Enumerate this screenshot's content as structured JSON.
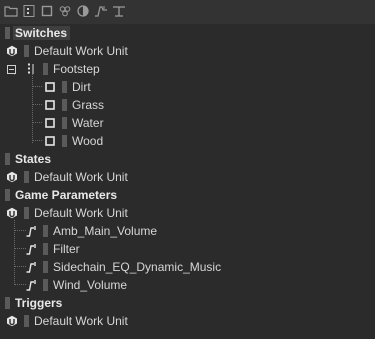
{
  "toolbar": {
    "icons": [
      "folder-icon",
      "switch-group-icon",
      "switch-icon",
      "state-group-icon",
      "state-icon",
      "game-parameter-icon",
      "trigger-icon"
    ]
  },
  "tree": {
    "switches": {
      "header": "Switches",
      "work_unit": "Default Work Unit",
      "group": "Footstep",
      "items": [
        "Dirt",
        "Grass",
        "Water",
        "Wood"
      ]
    },
    "states": {
      "header": "States",
      "work_unit": "Default Work Unit"
    },
    "game_parameters": {
      "header": "Game Parameters",
      "work_unit": "Default Work Unit",
      "items": [
        "Amb_Main_Volume",
        "Filter",
        "Sidechain_EQ_Dynamic_Music",
        "Wind_Volume"
      ]
    },
    "triggers": {
      "header": "Triggers",
      "work_unit": "Default Work Unit"
    }
  },
  "colors": {
    "background": "#2b2b2b",
    "toolbar": "#333333",
    "selected_header_bg": "#3f3f3f",
    "text": "#d6d6d6",
    "work_unit_bar": "#5a5a5a"
  }
}
